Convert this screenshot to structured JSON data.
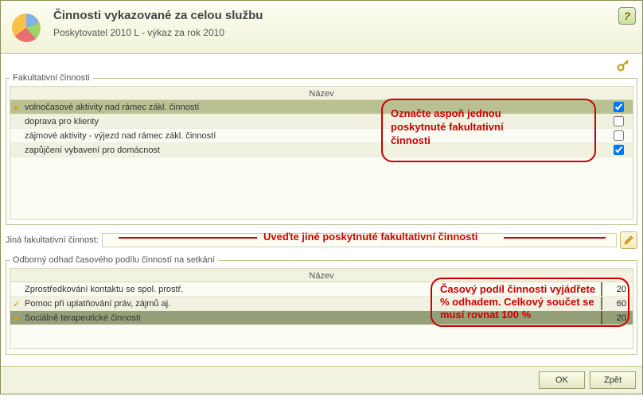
{
  "header": {
    "title": "Činnosti vykazované za celou službu",
    "subtitle": "Poskytovatel 2010 L - výkaz za rok 2010"
  },
  "fieldset1": {
    "legend": "Fakultativní činnosti",
    "column": "Název",
    "rows": [
      {
        "name": "volnočasové aktivity nad rámec zákl. činností",
        "checked": true,
        "selected": true,
        "mark": ""
      },
      {
        "name": "doprava pro klienty",
        "checked": false,
        "selected": false,
        "mark": ""
      },
      {
        "name": "zájmové aktivity - výjezd nad rámec zákl. činností",
        "checked": false,
        "selected": false,
        "mark": ""
      },
      {
        "name": "zapůjčení vybavení pro domácnost",
        "checked": true,
        "selected": false,
        "mark": ""
      }
    ]
  },
  "other": {
    "label": "Jiná fakultativní činnost:",
    "value": ""
  },
  "fieldset2": {
    "legend": "Odborný odhad časového podílu činností na setkání",
    "column": "Název",
    "rows": [
      {
        "name": "Zprostředkování kontaktu se spol. prostř.",
        "value": "20",
        "selected": false,
        "mark": ""
      },
      {
        "name": "Pomoc při uplatňování práv, zájmů aj.",
        "value": "60",
        "selected": false,
        "mark": "✓"
      },
      {
        "name": "Sociálně terapeutické činnosti",
        "value": "20",
        "selected": true,
        "mark": ""
      }
    ]
  },
  "annotations": {
    "a1": "Označte aspoň jednou poskytnuté fakultativní činnosti",
    "a1_l1": "Označte aspoň jednou",
    "a1_l2": "poskytnuté fakultativní",
    "a1_l3": "činnosti",
    "a2": "Uveďte jiné poskytnuté fakultativní činnosti",
    "a3": "Časový podíl činnosti vyjádřete % odhadem. Celkový součet se musí rovnat 100 %",
    "a3_l1": "Časový podíl činnosti vyjádřete",
    "a3_l2": "% odhadem. Celkový součet se",
    "a3_l3": "musí rovnat 100 %"
  },
  "buttons": {
    "ok": "OK",
    "back": "Zpět"
  }
}
